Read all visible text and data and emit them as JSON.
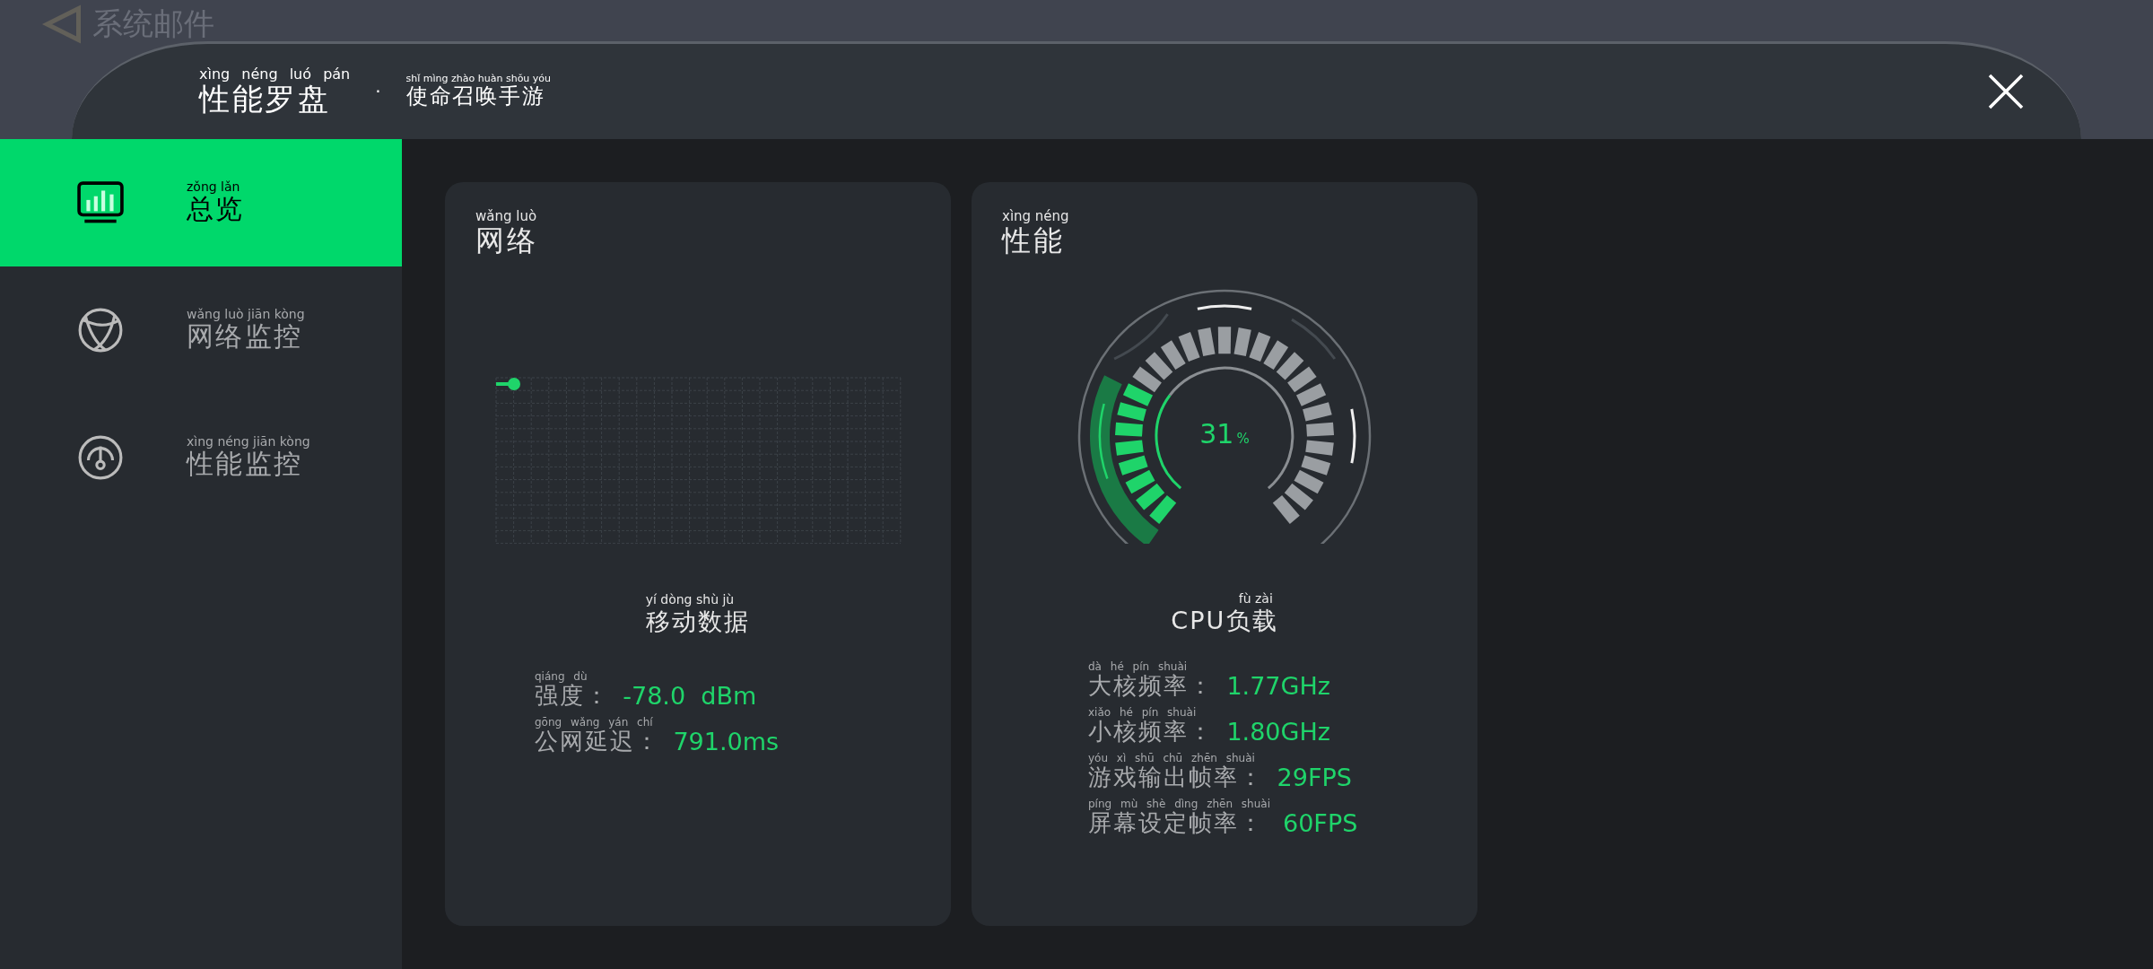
{
  "background_text": "系统邮件",
  "header": {
    "title": {
      "text": "性能罗盘",
      "pinyin": "xìng néng luó pán"
    },
    "separator": "·",
    "game": {
      "text": "使命召唤手游",
      "pinyin": "shǐ mìng zhào huàn shǒu yóu"
    }
  },
  "sidebar": {
    "items": [
      {
        "kind": "overview",
        "selected": true,
        "label": {
          "text": "总览",
          "pinyin": "zǒng lǎn"
        }
      },
      {
        "kind": "network",
        "selected": false,
        "label": {
          "text": "网络监控",
          "pinyin": "wǎng luò jiān kòng"
        }
      },
      {
        "kind": "performance",
        "selected": false,
        "label": {
          "text": "性能监控",
          "pinyin": "xìng néng jiān kòng"
        }
      }
    ]
  },
  "network": {
    "title": {
      "text": "网络",
      "pinyin": "wǎng luò"
    },
    "chart_label": {
      "text": "移动数据",
      "pinyin": "yí dòng shù jù"
    },
    "stats": [
      {
        "label": {
          "text": "强度：",
          "pinyin": "qiáng dù"
        },
        "value": "-78.0  dBm"
      },
      {
        "label": {
          "text": "公网延迟：",
          "pinyin": "gōng wǎng yán chí"
        },
        "value": "791.0ms"
      }
    ]
  },
  "performance": {
    "title": {
      "text": "性能",
      "pinyin": "xìng néng"
    },
    "gauge": {
      "level": 0.31,
      "value": "31",
      "unit": "%"
    },
    "gauge_label": {
      "text": "CPU负载",
      "pinyin": "fù zài"
    },
    "stats": [
      {
        "label": {
          "text": "大核频率：",
          "pinyin": "dà hé pín shuài"
        },
        "value": "1.77GHz"
      },
      {
        "label": {
          "text": "小核频率：",
          "pinyin": "xiǎo hé pín shuài"
        },
        "value": "1.80GHz"
      },
      {
        "label": {
          "text": "游戏输出帧率：",
          "pinyin": "yóu xì shū chū zhēn shuài"
        },
        "value": "29FPS"
      },
      {
        "label": {
          "text": "屏幕设定帧率：",
          "pinyin": "píng mù shè dìng zhēn shuài"
        },
        "value": "60FPS"
      }
    ]
  }
}
